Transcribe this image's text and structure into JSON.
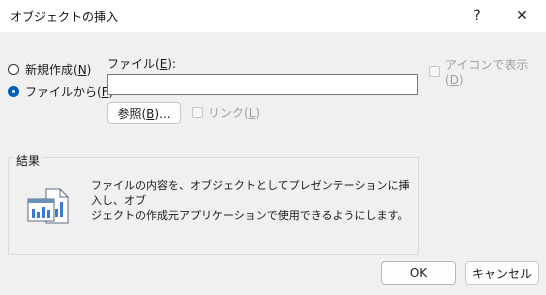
{
  "window": {
    "title": "オブジェクトの挿入",
    "help_glyph": "?",
    "close_glyph": "✕"
  },
  "options": {
    "create_new": {
      "label": "新規作成(",
      "key": "N",
      "suffix": ")",
      "selected": false
    },
    "from_file": {
      "label": "ファイルから(",
      "key": "F",
      "suffix": ")",
      "selected": true
    }
  },
  "file_field": {
    "label": "ファイル(",
    "key": "E",
    "suffix": "):",
    "value": ""
  },
  "browse_button": {
    "label": "参照(",
    "key": "B",
    "suffix": ")..."
  },
  "link_checkbox": {
    "label": "リンク(",
    "key": "L",
    "suffix": ")",
    "checked": false,
    "enabled": false
  },
  "display_as_icon": {
    "label": "アイコンで表示(",
    "key": "D",
    "suffix": ")",
    "checked": false,
    "enabled": false
  },
  "result": {
    "label": "結果",
    "line1": "ファイルの内容を、オブジェクトとしてプレゼンテーションに挿入し、オブ",
    "line2": "ジェクトの作成元アプリケーションで使用できるようにします。",
    "icon": "embed-document-icon"
  },
  "buttons": {
    "ok": "OK",
    "cancel": "キャンセル"
  },
  "colors": {
    "accent": "#005fb8",
    "dialog_bg": "#f0f0f0",
    "titlebar_bg": "#ffffff",
    "disabled_text": "#a0a0a0"
  }
}
